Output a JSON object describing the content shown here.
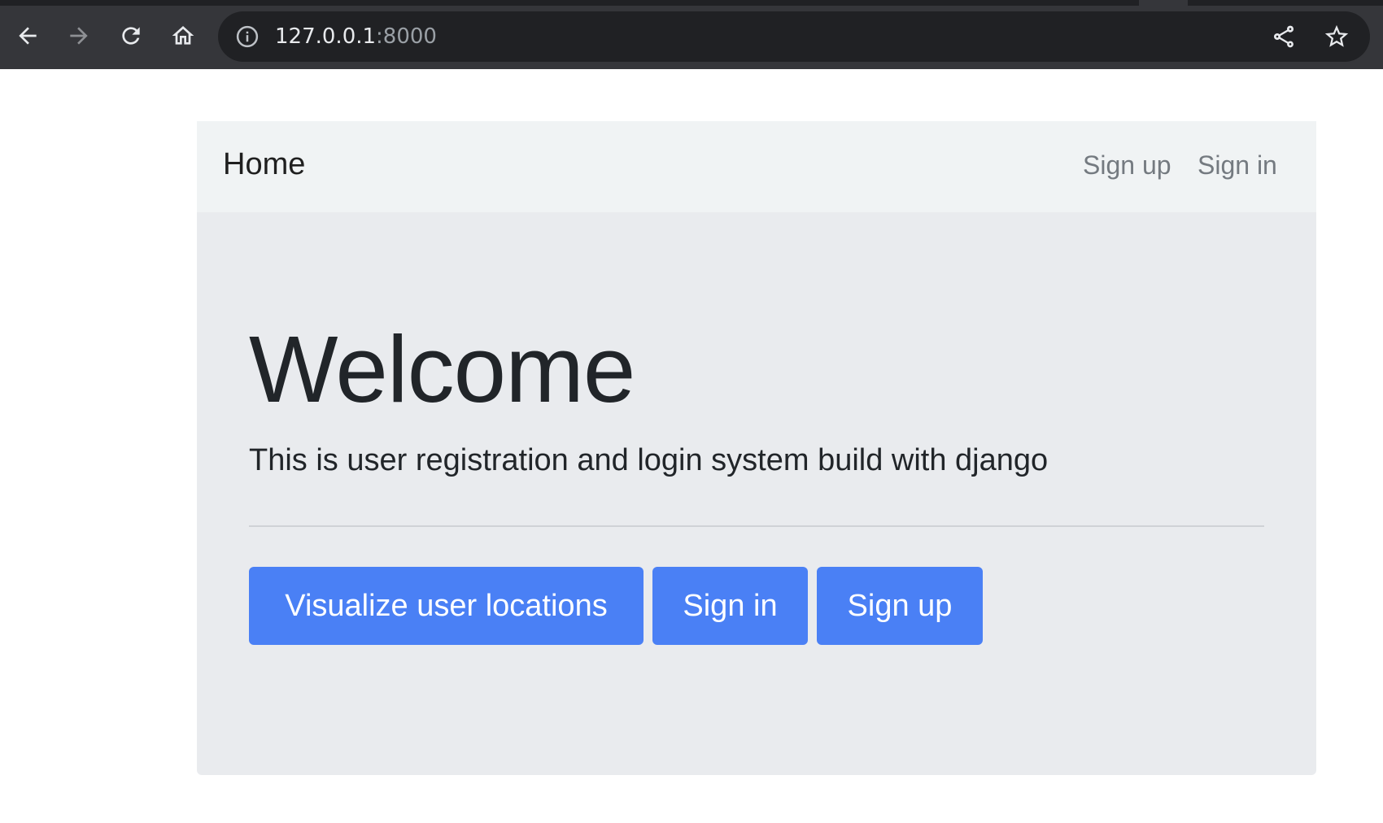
{
  "browser": {
    "url_host": "127.0.0.1",
    "url_port": ":8000",
    "icons": {
      "back": "arrow-left-icon",
      "forward": "arrow-right-icon",
      "reload": "reload-icon",
      "home": "home-icon",
      "site_info": "info-icon",
      "share": "share-icon",
      "bookmark": "star-icon"
    }
  },
  "navbar": {
    "brand": "Home",
    "links": {
      "signup": "Sign up",
      "signin": "Sign in"
    }
  },
  "hero": {
    "title": "Welcome",
    "lead": "This is user registration and login system build with django",
    "buttons": {
      "visualize": "Visualize user locations",
      "signin": "Sign in",
      "signup": "Sign up"
    }
  },
  "colors": {
    "chrome_bg": "#35363a",
    "omnibox_bg": "#202124",
    "navbar_bg": "#f0f3f4",
    "jumbotron_bg": "#e9ebee",
    "primary_button": "#4a80f5",
    "nav_link": "#747a80",
    "text": "#212529"
  }
}
